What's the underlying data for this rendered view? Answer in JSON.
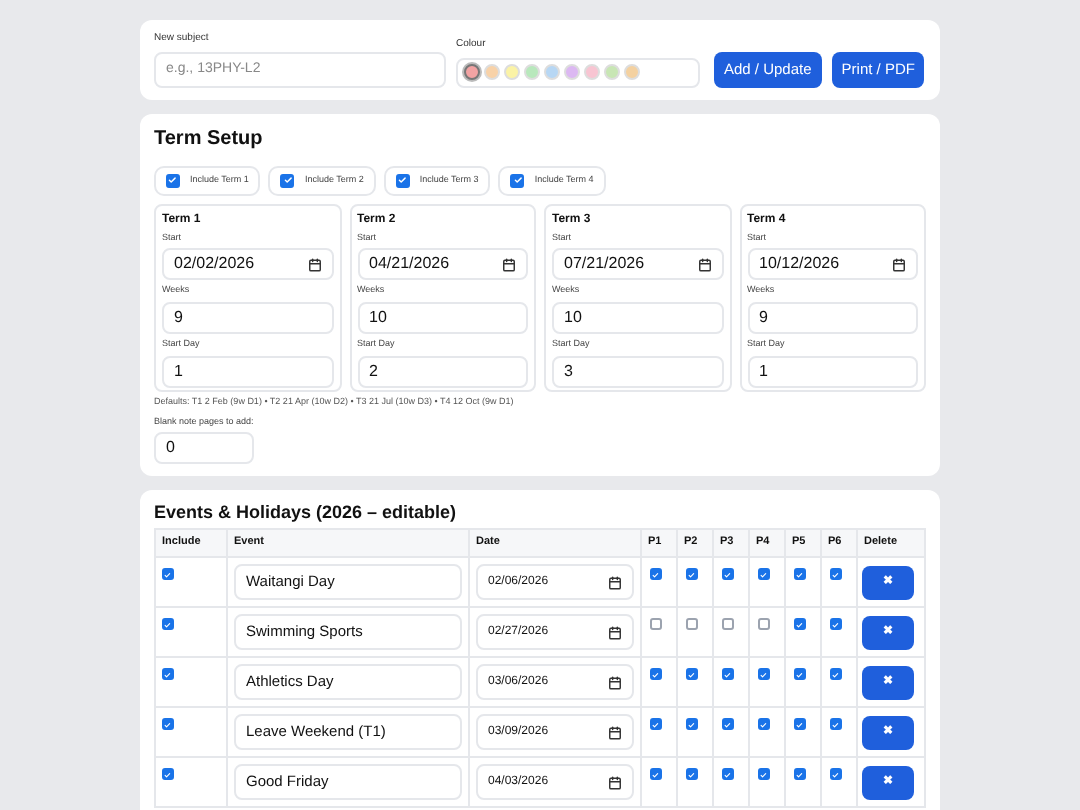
{
  "subject": {
    "label": "New subject",
    "placeholder": "e.g., 13PHY-L2"
  },
  "colour": {
    "label": "Colour",
    "swatches": [
      {
        "color": "#f2a3a3",
        "selected": true
      },
      {
        "color": "#f8d2a8",
        "selected": false
      },
      {
        "color": "#fbf3a6",
        "selected": false
      },
      {
        "color": "#b8e8bc",
        "selected": false
      },
      {
        "color": "#b7d7f4",
        "selected": false
      },
      {
        "color": "#dcb8f2",
        "selected": false
      },
      {
        "color": "#f8c5d2",
        "selected": false
      },
      {
        "color": "#c8e6b4",
        "selected": false
      },
      {
        "color": "#f4d1a0",
        "selected": false
      }
    ]
  },
  "buttons": [
    "Add / Update",
    "Print / PDF"
  ],
  "term_setup": {
    "title": "Term Setup",
    "includes": [
      {
        "label": "Include Term 1",
        "checked": true
      },
      {
        "label": "Include Term 2",
        "checked": true
      },
      {
        "label": "Include Term 3",
        "checked": true
      },
      {
        "label": "Include Term 4",
        "checked": true
      }
    ],
    "terms": [
      {
        "name": "Term 1",
        "start_label": "Start",
        "start": "02/02/2026",
        "weeks_label": "Weeks",
        "weeks": "9",
        "day_label": "Start Day",
        "day": "1"
      },
      {
        "name": "Term 2",
        "start_label": "Start",
        "start": "04/21/2026",
        "weeks_label": "Weeks",
        "weeks": "10",
        "day_label": "Start Day",
        "day": "2"
      },
      {
        "name": "Term 3",
        "start_label": "Start",
        "start": "07/21/2026",
        "weeks_label": "Weeks",
        "weeks": "10",
        "day_label": "Start Day",
        "day": "3"
      },
      {
        "name": "Term 4",
        "start_label": "Start",
        "start": "10/12/2026",
        "weeks_label": "Weeks",
        "weeks": "9",
        "day_label": "Start Day",
        "day": "1"
      }
    ],
    "defaults": "Defaults: T1 2 Feb (9w D1) • T2 21 Apr (10w D2) • T3 21 Jul (10w D3) • T4 12 Oct (9w D1)",
    "blank_label": "Blank note pages to add:",
    "blank": "0"
  },
  "events": {
    "title": "Events & Holidays (2026 – editable)",
    "columns": [
      "Include",
      "Event",
      "Date",
      "P1",
      "P2",
      "P3",
      "P4",
      "P5",
      "P6",
      "Delete"
    ],
    "rows": [
      {
        "include": true,
        "event": "Waitangi Day",
        "date": "02/06/2026",
        "periods": [
          true,
          true,
          true,
          true,
          true,
          true
        ],
        "delete": "✖"
      },
      {
        "include": true,
        "event": "Swimming Sports",
        "date": "02/27/2026",
        "periods": [
          false,
          false,
          false,
          false,
          true,
          true
        ],
        "delete": "✖"
      },
      {
        "include": true,
        "event": "Athletics Day",
        "date": "03/06/2026",
        "periods": [
          true,
          true,
          true,
          true,
          true,
          true
        ],
        "delete": "✖"
      },
      {
        "include": true,
        "event": "Leave Weekend (T1)",
        "date": "03/09/2026",
        "periods": [
          true,
          true,
          true,
          true,
          true,
          true
        ],
        "delete": "✖"
      },
      {
        "include": true,
        "event": "Good Friday",
        "date": "04/03/2026",
        "periods": [
          true,
          true,
          true,
          true,
          true,
          true
        ],
        "delete": "✖"
      }
    ]
  }
}
